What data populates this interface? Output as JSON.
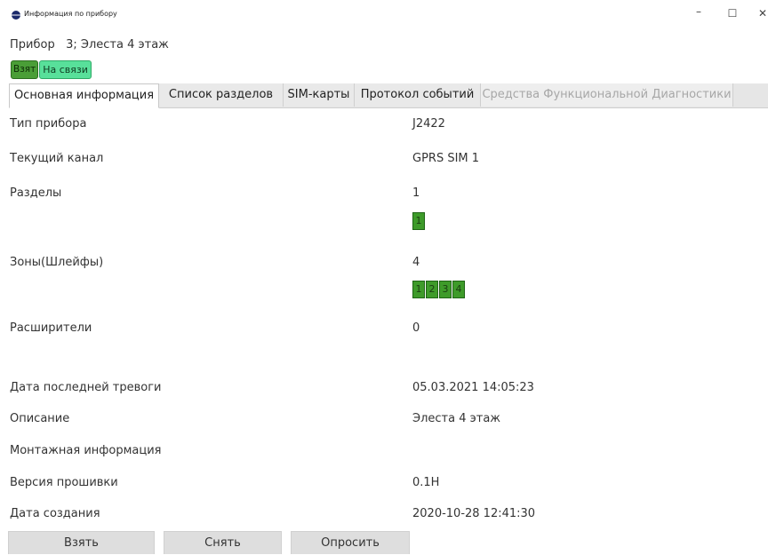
{
  "window": {
    "title": "Информация по прибору",
    "minimize": "–",
    "maximize": "☐",
    "close": "✕"
  },
  "device": {
    "label": "Прибор",
    "info": "3; Элеста 4 этаж"
  },
  "badges": {
    "armed": "Взят",
    "online": "На связи"
  },
  "tabs": [
    {
      "label": "Основная информация"
    },
    {
      "label": "Список разделов"
    },
    {
      "label": "SIM-карты"
    },
    {
      "label": "Протокол событий"
    },
    {
      "label": "Средства Функциональной Диагностики"
    }
  ],
  "rows": {
    "device_type": {
      "label": "Тип прибора",
      "value": "J2422"
    },
    "channel": {
      "label": "Текущий канал",
      "value": "GPRS SIM 1"
    },
    "partitions": {
      "label": "Разделы",
      "value": "1",
      "chips": [
        "1"
      ]
    },
    "zones": {
      "label": "Зоны(Шлейфы)",
      "value": "4",
      "chips": [
        "1",
        "2",
        "3",
        "4"
      ]
    },
    "expanders": {
      "label": "Расширители",
      "value": "0"
    },
    "last_alarm": {
      "label": "Дата последней тревоги",
      "value": "05.03.2021 14:05:23"
    },
    "description": {
      "label": "Описание",
      "value": "Элеста 4 этаж"
    },
    "mount_info": {
      "label": "Монтажная информация",
      "value": ""
    },
    "firmware": {
      "label": "Версия прошивки",
      "value": "0.1H"
    },
    "created": {
      "label": "Дата создания",
      "value": "2020-10-28 12:41:30"
    }
  },
  "buttons": {
    "arm": "Взять",
    "disarm": "Снять",
    "poll": "Опросить"
  },
  "colors": {
    "chip_green": "#3e9b2a",
    "online_green": "#58e09a",
    "armed_green": "#4a9e37"
  }
}
